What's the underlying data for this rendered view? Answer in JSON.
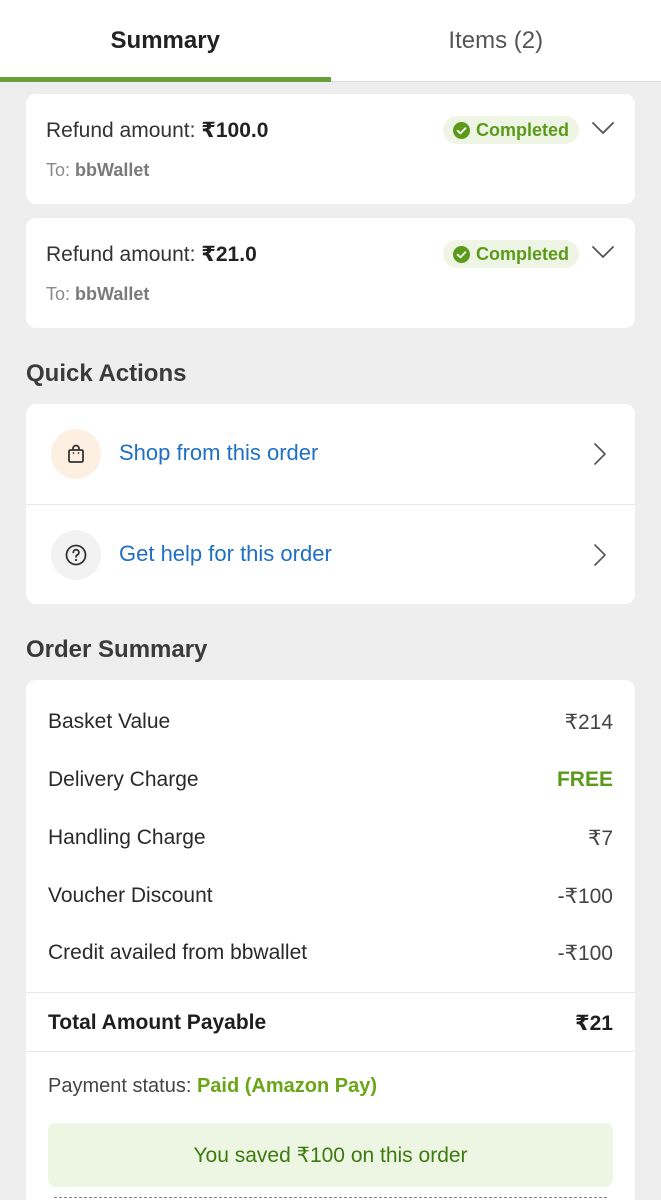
{
  "tabs": [
    {
      "label": "Summary"
    },
    {
      "label": "Items (2)"
    }
  ],
  "refunds": [
    {
      "amount_label": "Refund amount: ",
      "amount": "₹100.0",
      "status": "Completed",
      "to_label": "To: ",
      "to": "bbWallet"
    },
    {
      "amount_label": "Refund amount: ",
      "amount": "₹21.0",
      "status": "Completed",
      "to_label": "To: ",
      "to": "bbWallet"
    }
  ],
  "quick_actions": {
    "title": "Quick Actions",
    "items": [
      {
        "label": "Shop from this order",
        "icon": "shopping-bag-icon"
      },
      {
        "label": "Get help for this order",
        "icon": "help-circle-icon"
      }
    ]
  },
  "order_summary": {
    "title": "Order Summary",
    "rows": [
      {
        "label": "Basket Value",
        "value": "₹214"
      },
      {
        "label": "Delivery Charge",
        "value": "FREE"
      },
      {
        "label": "Handling Charge",
        "value": "₹7"
      },
      {
        "label": "Voucher Discount",
        "value": "-₹100"
      },
      {
        "label": "Credit availed from bbwallet",
        "value": "-₹100"
      }
    ],
    "total": {
      "label": "Total Amount Payable",
      "value": "₹21"
    },
    "payment_status_label": "Payment status: ",
    "payment_status_value": "Paid (Amazon Pay)",
    "savings_text": "You saved ₹100 on this order"
  },
  "colors": {
    "accent_green": "#689f38",
    "status_green": "#5b9a1a",
    "link_blue": "#1f6fc5"
  }
}
